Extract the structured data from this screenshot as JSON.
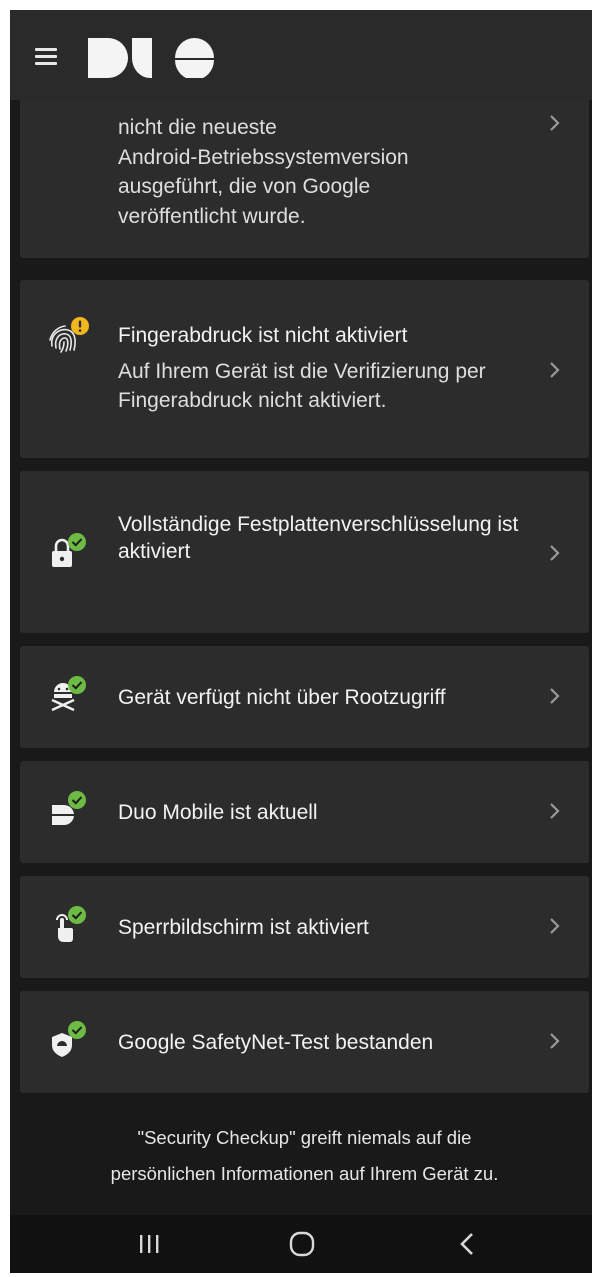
{
  "app": {
    "logo_icon": "duo-logo",
    "menu_icon": "hamburger-menu-icon"
  },
  "colors": {
    "background": "#191919",
    "card": "#2c2c2c",
    "ok_badge": "#6dbb45",
    "warn_badge": "#f2b61f"
  },
  "cards": [
    {
      "title": "",
      "description": "nicht die neueste\nAndroid-Betriebssystemversion\nausgeführt, die von Google\nveröffentlicht wurde.",
      "icon": "android-os-icon",
      "status": "warning"
    },
    {
      "title": "Fingerabdruck ist nicht aktiviert",
      "description": "Auf Ihrem Gerät ist die Verifizierung per Fingerabdruck nicht aktiviert.",
      "icon": "fingerprint-icon",
      "status": "warning"
    },
    {
      "title": "Vollständige Festplattenverschlüsselung ist aktiviert",
      "description": "",
      "icon": "lock-icon",
      "status": "ok"
    },
    {
      "title": "Gerät verfügt nicht über Rootzugriff",
      "description": "",
      "icon": "no-root-icon",
      "status": "ok"
    },
    {
      "title": "Duo Mobile ist aktuell",
      "description": "",
      "icon": "duo-mobile-icon",
      "status": "ok"
    },
    {
      "title": "Sperrbildschirm ist aktiviert",
      "description": "",
      "icon": "touch-lock-icon",
      "status": "ok"
    },
    {
      "title": "Google SafetyNet-Test bestanden",
      "description": "",
      "icon": "shield-android-icon",
      "status": "ok"
    }
  ],
  "footer": {
    "line1": "\"Security Checkup\" greift niemals auf die",
    "line2": "persönlichen Informationen auf Ihrem Gerät zu."
  },
  "navbar": {
    "recents_icon": "recent-apps-icon",
    "home_icon": "home-icon",
    "back_icon": "back-icon"
  }
}
